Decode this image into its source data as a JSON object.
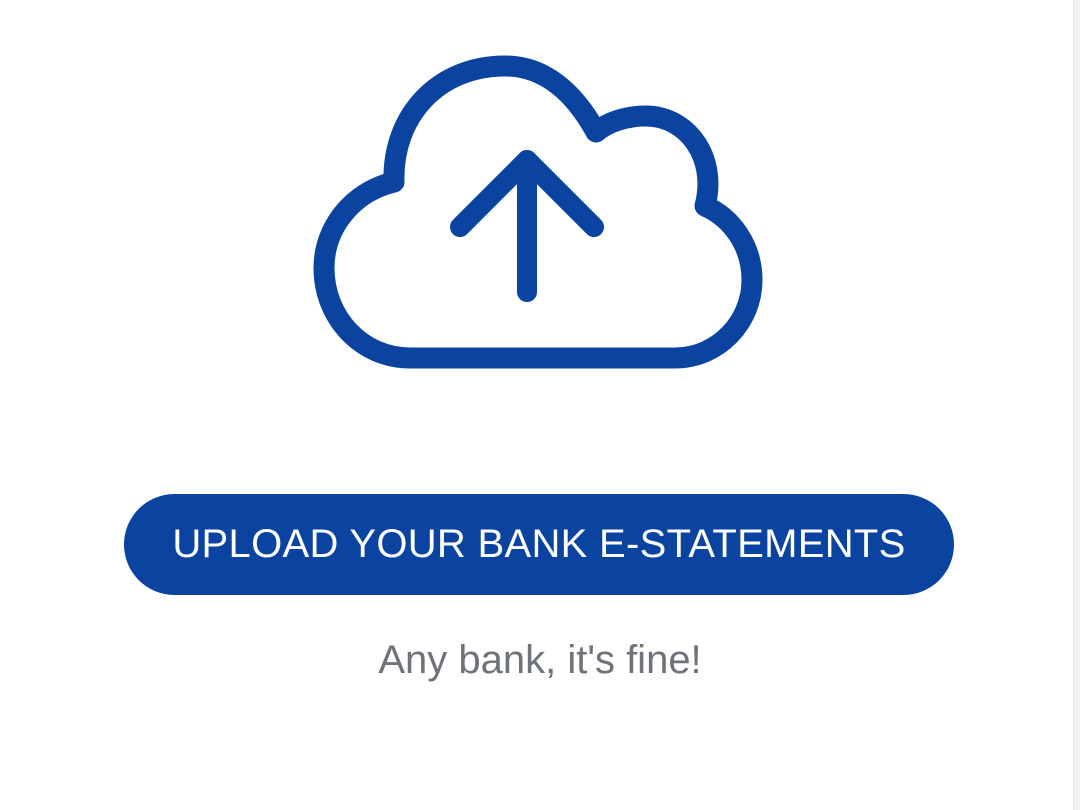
{
  "upload": {
    "icon": "cloud-upload-icon",
    "button_label": "UPLOAD YOUR BANK E-STATEMENTS",
    "subtitle": "Any bank, it's fine!"
  },
  "colors": {
    "accent": "#0a43a0",
    "subtitle_text": "#6e727a",
    "background": "#ffffff"
  }
}
